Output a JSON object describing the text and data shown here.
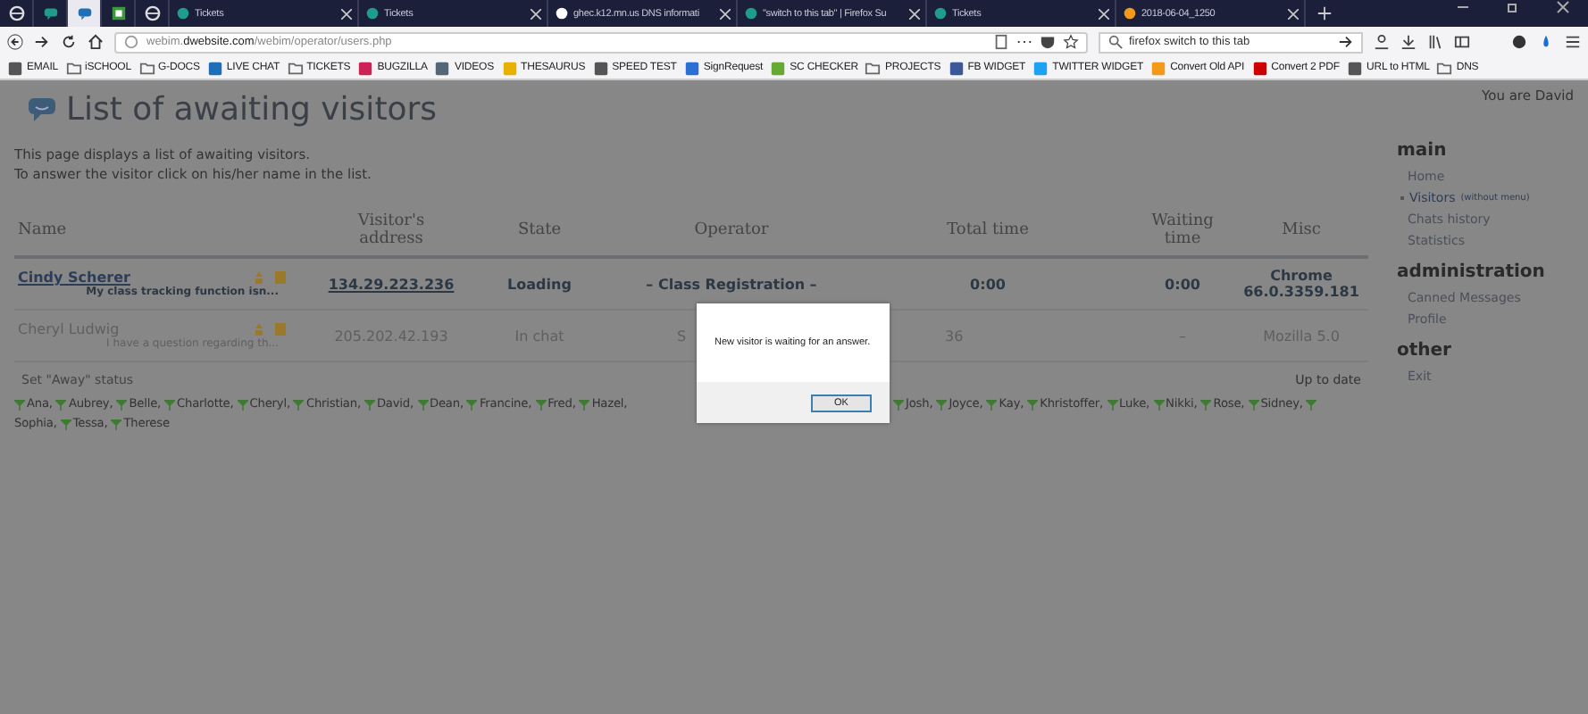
{
  "browser": {
    "tabs": [
      {
        "kind": "pinned",
        "selected": false
      },
      {
        "kind": "pinned",
        "selected": false
      },
      {
        "kind": "pinned",
        "selected": true
      },
      {
        "kind": "pinned",
        "selected": false
      },
      {
        "kind": "pinned",
        "selected": false
      },
      {
        "kind": "page",
        "label": "Tickets",
        "selected": false
      },
      {
        "kind": "page",
        "label": "Tickets",
        "selected": false
      },
      {
        "kind": "page",
        "label": "ghec.k12.mn.us DNS informati",
        "selected": false
      },
      {
        "kind": "page",
        "label": "\"switch to this tab\" | Firefox Su",
        "selected": false
      },
      {
        "kind": "page",
        "label": "Tickets",
        "selected": false
      },
      {
        "kind": "page",
        "label": "2018-06-04_1250",
        "selected": false
      }
    ],
    "address": {
      "host": "webim.",
      "domain": "dwebsite.com",
      "path": "/webim/operator/users.php"
    },
    "search": {
      "value": "firefox switch to this tab"
    },
    "bookmarks": [
      {
        "kind": "site",
        "label": "EMAIL"
      },
      {
        "kind": "folder",
        "label": "iSCHOOL"
      },
      {
        "kind": "folder",
        "label": "G-DOCS"
      },
      {
        "kind": "site",
        "label": "LIVE CHAT"
      },
      {
        "kind": "folder",
        "label": "TICKETS"
      },
      {
        "kind": "site",
        "label": "BUGZILLA"
      },
      {
        "kind": "site",
        "label": "VIDEOS"
      },
      {
        "kind": "site",
        "label": "THESAURUS"
      },
      {
        "kind": "site",
        "label": "SPEED TEST"
      },
      {
        "kind": "site",
        "label": "SignRequest"
      },
      {
        "kind": "site",
        "label": "SC CHECKER"
      },
      {
        "kind": "folder",
        "label": "PROJECTS"
      },
      {
        "kind": "site",
        "label": "FB WIDGET"
      },
      {
        "kind": "site",
        "label": "TWITTER WIDGET"
      },
      {
        "kind": "site",
        "label": "Convert Old API"
      },
      {
        "kind": "site",
        "label": "Convert 2 PDF"
      },
      {
        "kind": "site",
        "label": "URL to HTML"
      },
      {
        "kind": "folder",
        "label": "DNS"
      }
    ]
  },
  "page": {
    "title": "List of awaiting visitors",
    "user": "You are David",
    "description": [
      "This page displays a list of awaiting visitors.",
      "To answer the visitor click on his/her name in the list."
    ],
    "table": {
      "columns": [
        "Name",
        "Visitor's address",
        "State",
        "Operator",
        "Total time",
        "Waiting time",
        "Misc"
      ],
      "rows": [
        {
          "waiting": true,
          "name": "Cindy Scherer",
          "message": "My class tracking function isn...",
          "address": "134.29.223.236",
          "state": "Loading",
          "operator": "– Class Registration –",
          "total_time": "0:00",
          "waiting_time": "0:00",
          "misc": "Chrome 66.0.3359.181"
        },
        {
          "waiting": false,
          "name": "Cheryl Ludwig",
          "message": "I have a question regarding th...",
          "address": "205.202.42.193",
          "state": "In chat",
          "operator": "S",
          "total_time": "36",
          "waiting_time": "–",
          "misc": "Mozilla 5.0"
        }
      ]
    },
    "away_link": "Set \"Away\" status",
    "update_status": "Up to date",
    "operators_before": [
      "Ana,",
      "Aubrey,",
      "Belle,",
      "Charlotte,",
      "Cheryl,",
      "Christian,",
      "David,",
      "Dean,",
      "Francine,",
      "Fred,",
      "Hazel,"
    ],
    "operators_after": [
      "Josh,",
      "Joyce,",
      "Kay,",
      "Khristoffer,",
      "Luke,",
      "Nikki,",
      "Rose,",
      "Sidney,"
    ],
    "operators_line2": [
      "Sophia,",
      "Tessa,",
      "Therese"
    ],
    "sidebar": [
      {
        "title": "main",
        "items": [
          {
            "label": "Home",
            "selected": false
          },
          {
            "label": "Visitors",
            "note": "(without menu)",
            "selected": true
          },
          {
            "label": "Chats history",
            "selected": false
          },
          {
            "label": "Statistics",
            "selected": false
          }
        ]
      },
      {
        "title": "administration",
        "items": [
          {
            "label": "Canned Messages",
            "selected": false
          },
          {
            "label": "Profile",
            "selected": false
          }
        ]
      },
      {
        "title": "other",
        "items": [
          {
            "label": "Exit",
            "selected": false
          }
        ]
      }
    ]
  },
  "dialog": {
    "message": "New visitor is waiting for an answer.",
    "button": "OK"
  }
}
